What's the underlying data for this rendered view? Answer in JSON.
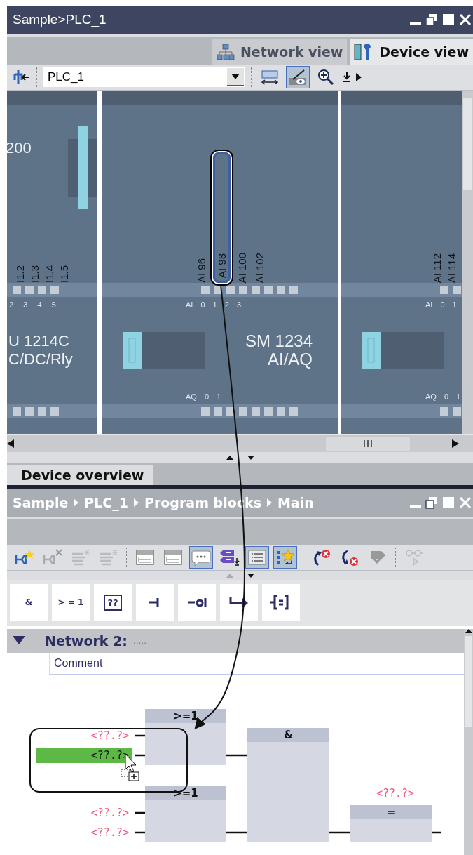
{
  "device_window": {
    "title": "Sample>PLC_1",
    "tabs": [
      {
        "label": "Network view",
        "kind": "network",
        "selected": false
      },
      {
        "label": "Device view",
        "kind": "device",
        "selected": true
      }
    ],
    "device_selector": {
      "value": "PLC_1"
    },
    "toolbar": [
      {
        "kind": "fit",
        "pressed": false
      },
      {
        "kind": "view",
        "pressed": true
      },
      {
        "kind": "zoom",
        "pressed": false
      }
    ],
    "modules": [
      {
        "kind": "cpu",
        "badge": "200",
        "channels": [
          {
            "label": "I1.2",
            "selected": false
          },
          {
            "label": "I1.3",
            "selected": false
          },
          {
            "label": "I1.4",
            "selected": false
          },
          {
            "label": "I1.5",
            "selected": false
          }
        ],
        "channel_numbers": "2 .3 .4 .5",
        "name_lines": [
          "U 1214C",
          "C/DC/Rly"
        ]
      },
      {
        "kind": "signal",
        "channels": [
          {
            "label": "AI 96",
            "selected": false
          },
          {
            "label": "AI 98",
            "selected": true
          },
          {
            "label": "AI 100",
            "selected": false
          },
          {
            "label": "AI 102",
            "selected": false
          }
        ],
        "channel_numbers": "AI 0 1 2 3",
        "name_lines": [
          "SM 1234",
          "AI/AQ"
        ],
        "output_numbers": "AQ 0 1"
      },
      {
        "kind": "signal-edge",
        "channels": [
          {
            "label": "AI 112",
            "selected": false
          },
          {
            "label": "AI 114",
            "selected": false
          }
        ],
        "channel_numbers": "AI 0 1",
        "output_numbers": "AQ 0 1"
      }
    ]
  },
  "overview_tab": {
    "label": "Device overview"
  },
  "editor": {
    "breadcrumb": [
      "Sample",
      "PLC_1",
      "Program blocks",
      "Main"
    ],
    "toolbar": [
      {
        "kind": "insert-network",
        "pressed": false,
        "disabled": false
      },
      {
        "kind": "delete-network",
        "pressed": false,
        "disabled": true
      },
      {
        "kind": "insert-line",
        "pressed": false,
        "disabled": true
      },
      {
        "kind": "delete-line",
        "pressed": false,
        "disabled": true
      },
      {
        "kind": "open-all",
        "pressed": false,
        "disabled": false
      },
      {
        "kind": "close-all",
        "pressed": false,
        "disabled": false
      },
      {
        "kind": "comments",
        "pressed": true,
        "disabled": false
      },
      {
        "kind": "operands",
        "pressed": false,
        "disabled": false
      },
      {
        "kind": "network-list",
        "pressed": true,
        "disabled": false
      },
      {
        "kind": "favorites",
        "pressed": true,
        "disabled": false
      },
      {
        "kind": "prev-error",
        "pressed": false,
        "disabled": false
      },
      {
        "kind": "next-error",
        "pressed": false,
        "disabled": false
      },
      {
        "kind": "check",
        "pressed": false,
        "disabled": false
      },
      {
        "kind": "monitor",
        "pressed": false,
        "disabled": true
      }
    ],
    "palette": [
      {
        "kind": "and",
        "label": "&"
      },
      {
        "kind": "or",
        "label": "> = 1"
      },
      {
        "kind": "empty-box",
        "label": "??"
      },
      {
        "kind": "input"
      },
      {
        "kind": "negated-input"
      },
      {
        "kind": "branch"
      },
      {
        "kind": "assignment"
      }
    ],
    "network": {
      "title": "Network 2:",
      "title_placeholder": ".....",
      "expanded": true,
      "comment": "Comment",
      "blocks": [
        {
          "label": ">=1"
        },
        {
          "label": ">=1"
        },
        {
          "label": "&"
        },
        {
          "label": "="
        }
      ],
      "operands": [
        {
          "text": "<??.?>",
          "selected": false
        },
        {
          "text": "<??.?>",
          "selected": true
        },
        {
          "text": "<??.?>",
          "selected": false
        },
        {
          "text": "<??.?>",
          "selected": false
        }
      ],
      "output_operand": "<??.?>"
    }
  }
}
